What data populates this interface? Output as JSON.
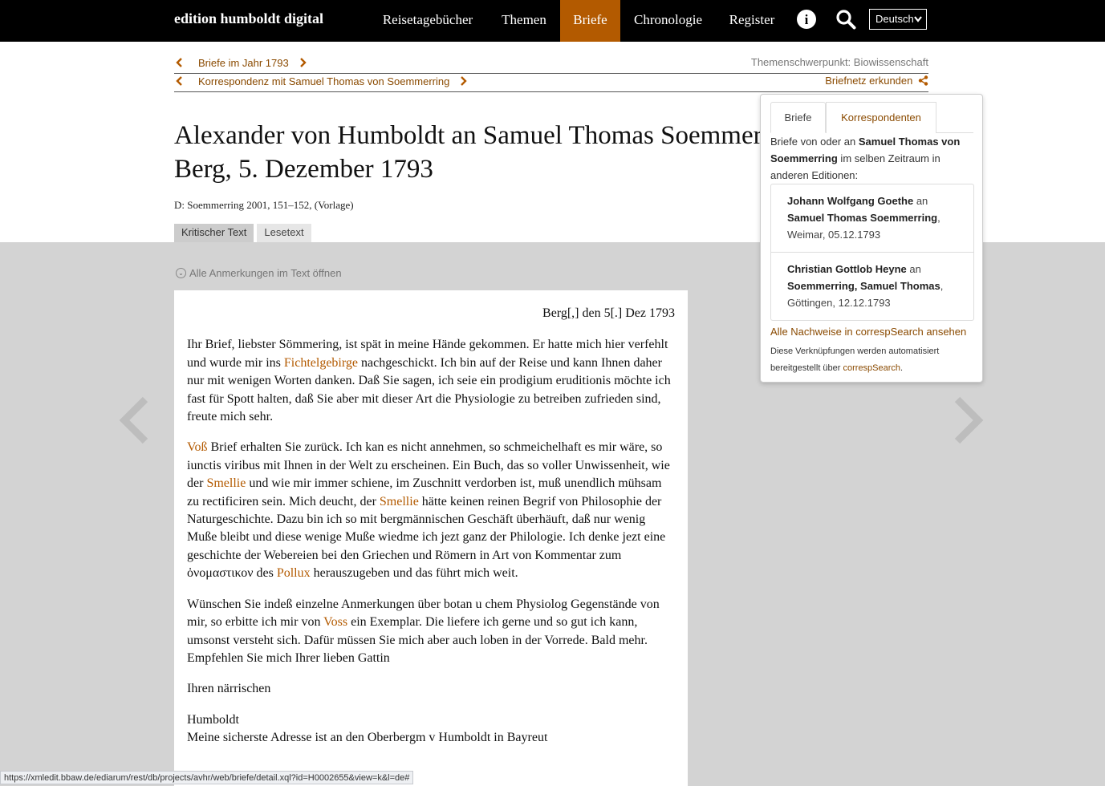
{
  "nav": {
    "brand": "edition humboldt digital",
    "items": [
      {
        "label": "Reisetagebücher"
      },
      {
        "label": "Themen"
      },
      {
        "label": "Briefe"
      },
      {
        "label": "Chronologie"
      },
      {
        "label": "Register"
      }
    ],
    "active": "Briefe",
    "info_glyph": "i",
    "language": "Deutsch",
    "icons": {
      "info": "info-icon",
      "search": "search-icon",
      "language_chevron": "chevron-down-icon"
    }
  },
  "breadcrumbs": {
    "year": "Briefe im Jahr 1793",
    "correspondence": "Korrespondenz mit Samuel Thomas von Soemmerring",
    "topic": "Themenschwerpunkt: Biowissenschaft",
    "network": "Briefnetz erkunden"
  },
  "header": {
    "title_line1": "Alexander von Humboldt an Samuel Thomas Soemmerring",
    "title_line2": "Berg, 5. Dezember 1793",
    "source": "D: Soemmerring 2001, 151–152, (Vorlage)"
  },
  "tabs": [
    {
      "label": "Kritischer Text",
      "active": true
    },
    {
      "label": "Lesetext",
      "active": false
    }
  ],
  "open_all_annotations": "Alle Anmerkungen im Text öffnen",
  "letter": {
    "date_line": "Berg[,] den 5[.] Dez 1793",
    "p1": {
      "a": "Ihr Brief, liebster Sömmering, ist spät in meine Hände gekommen. Er hatte mich hier verfehlt und wurde mir ins ",
      "ref1": "Fichtelgebirge",
      "b": " nachgeschickt. Ich bin auf der Reise und kann Ihnen daher nur mit wenigen Worten danken. Daß Sie sagen, ich seie ein prodigium eruditionis möchte ich fast für Spott halten, daß Sie aber mit dieser Art die Physiologie zu betreiben zufrieden sind, freute mich sehr."
    },
    "p2": {
      "ref1": "Voß",
      "a": " Brief erhalten Sie zurück. Ich kan es nicht annehmen, so schmeichelhaft es mir wäre, so iunctis viribus mit Ihnen in der Welt zu erscheinen. Ein Buch, das so voller Unwissenheit, wie der ",
      "ref2": "Smellie",
      "b": " und wie mir immer schiene, im Zuschnitt verdorben ist, muß unendlich mühsam zu rectificiren sein. Mich deucht, der ",
      "ref3": "Smellie",
      "c": " hätte keinen reinen Begrif von Philosophie der Naturgeschichte. Dazu bin ich so mit bergmännischen Geschäft überhäuft, daß nur wenig Muße bleibt und diese wenige Muße wiedme ich jezt ganz der Philologie. Ich denke jezt eine geschichte der Webereien bei den Griechen und Römern in Art von Kommentar zum ὀνομαστικον des ",
      "ref4": "Pollux",
      "d": " herauszugeben und das führt mich weit."
    },
    "p3": {
      "a": "Wünschen Sie indeß einzelne Anmerkungen über botan u chem Physiolog Gegenstände von mir, so erbitte ich mir von ",
      "ref1": "Voss",
      "b": " ein Exemplar. Die liefere ich gerne und so gut ich kann, umsonst versteht sich. Dafür müssen Sie mich aber auch loben in der Vorrede. Bald mehr. Empfehlen Sie mich Ihrer lieben Gattin"
    },
    "closing": "Ihren närrischen",
    "signature": "Humboldt",
    "postscript": "Meine sicherste Adresse ist an den Oberbergm v Humboldt in Bayreut"
  },
  "popover": {
    "tab_letters": "Briefe",
    "tab_correspondents": "Korrespondenten",
    "intro_a": "Briefe von oder an ",
    "intro_name": "Samuel Thomas von Soemmerring",
    "intro_b": " im selben Zeitraum in anderen Editionen:",
    "entries": [
      {
        "sender": "Johann Wolfgang Goethe",
        "conj": " an ",
        "recipient": "Samuel Thomas Soemmerring",
        "meta": ", Weimar, 05.12.1793"
      },
      {
        "sender": "Christian Gottlob Heyne",
        "conj": " an ",
        "recipient": "Soemmerring, Samuel Thomas",
        "meta": ", Göttingen, 12.12.1793"
      }
    ],
    "all_link": "Alle Nachweise in correspSearch ansehen",
    "note_a": "Diese Verknüpfungen werden automatisiert bereitgestellt über ",
    "note_link": "correspSearch",
    "note_b": "."
  },
  "statusbar": {
    "url": "https://xmledit.bbaw.de/ediarum/rest/db/projects/avhr/web/briefe/detail.xql?id=H0002655&view=k&l=de#"
  },
  "colors": {
    "accent": "#b35a00",
    "link": "#8a4a00",
    "topbar": "#000000",
    "page_bg": "#d3d3d3"
  }
}
